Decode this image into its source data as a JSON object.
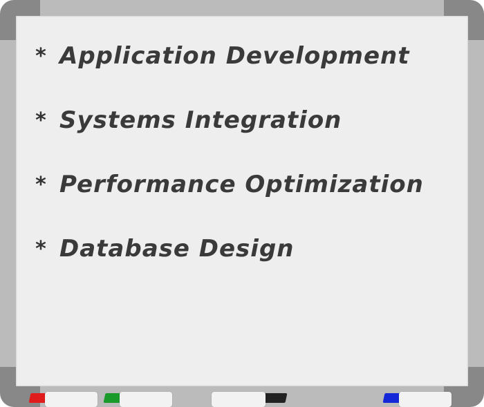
{
  "whiteboard": {
    "items": [
      {
        "bullet": "*",
        "label": "Application Development"
      },
      {
        "bullet": "*",
        "label": "Systems Integration"
      },
      {
        "bullet": "*",
        "label": "Performance Optimization"
      },
      {
        "bullet": "*",
        "label": "Database Design"
      }
    ],
    "markers": [
      {
        "color_name": "red",
        "color": "#e01b1b"
      },
      {
        "color_name": "green",
        "color": "#1a9a2a"
      },
      {
        "color_name": "black",
        "color": "#222222"
      },
      {
        "color_name": "blue",
        "color": "#1428d8"
      }
    ],
    "colors": {
      "board": "#eeeeee",
      "frame": "#bbbbbb",
      "frame_corner": "#888888",
      "ink": "#3a3a3a"
    }
  }
}
